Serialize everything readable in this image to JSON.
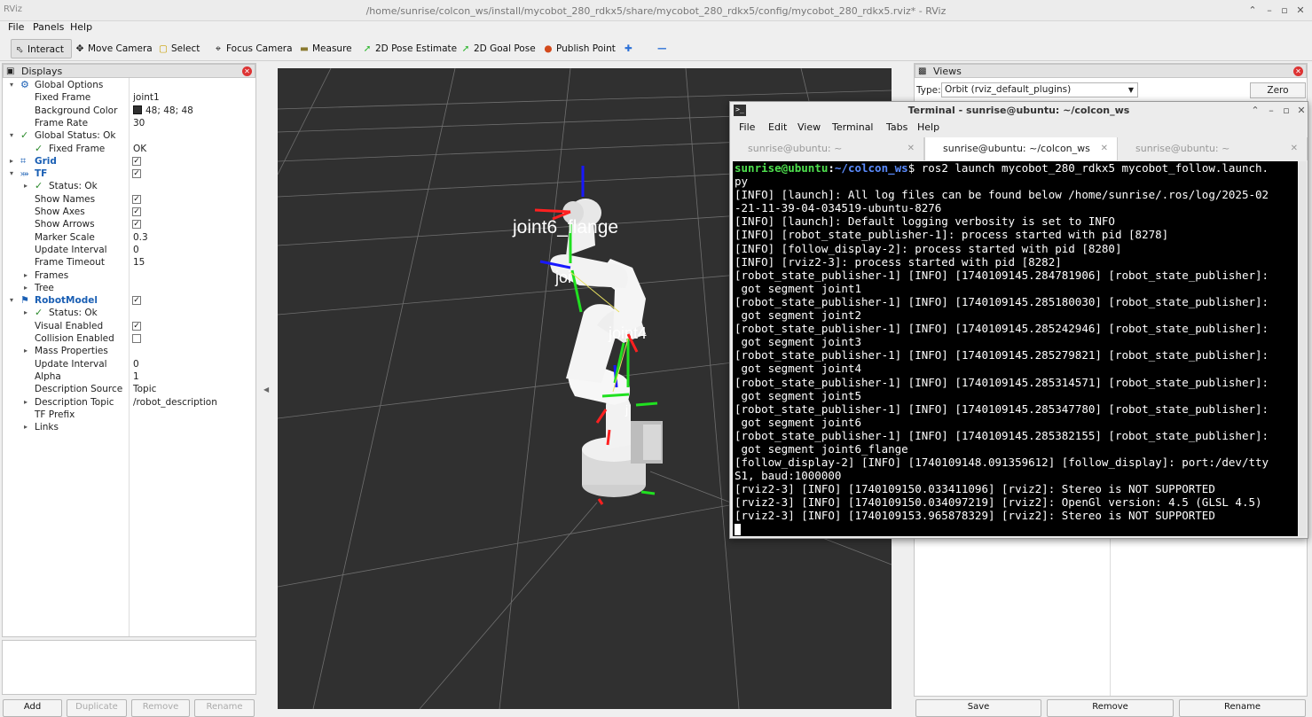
{
  "window": {
    "title": "/home/sunrise/colcon_ws/install/mycobot_280_rdkx5/share/mycobot_280_rdkx5/config/mycobot_280_rdkx5.rviz* - RViz",
    "logo": "RViz"
  },
  "menu": [
    "File",
    "Panels",
    "Help"
  ],
  "toolbar": {
    "interact": "Interact",
    "move_camera": "Move Camera",
    "select": "Select",
    "focus_camera": "Focus Camera",
    "measure": "Measure",
    "pose_estimate": "2D Pose Estimate",
    "goal_pose": "2D Goal Pose",
    "publish_point": "Publish Point"
  },
  "displays": {
    "title": "Displays",
    "rows": [
      {
        "name": "Global Options",
        "value": "",
        "depth": 0,
        "arrow": "open",
        "icon": "gear-icon",
        "check": null,
        "status": false,
        "blue": false
      },
      {
        "name": "Fixed Frame",
        "value": "joint1",
        "depth": 1,
        "arrow": "",
        "icon": "",
        "check": null,
        "status": false,
        "blue": false
      },
      {
        "name": "Background Color",
        "value": "48; 48; 48",
        "depth": 1,
        "arrow": "",
        "icon": "",
        "check": null,
        "status": false,
        "blue": false,
        "swatch": "#303030"
      },
      {
        "name": "Frame Rate",
        "value": "30",
        "depth": 1,
        "arrow": "",
        "icon": "",
        "check": null,
        "status": false,
        "blue": false
      },
      {
        "name": "Global Status: Ok",
        "value": "",
        "depth": 0,
        "arrow": "open",
        "icon": "",
        "check": null,
        "status": true,
        "blue": false
      },
      {
        "name": "Fixed Frame",
        "value": "OK",
        "depth": 1,
        "arrow": "",
        "icon": "",
        "check": null,
        "status": true,
        "blue": false
      },
      {
        "name": "Grid",
        "value": "",
        "depth": 0,
        "arrow": "closed",
        "icon": "grid-icon",
        "check": true,
        "status": false,
        "blue": true
      },
      {
        "name": "TF",
        "value": "",
        "depth": 0,
        "arrow": "open",
        "icon": "axes-icon",
        "check": true,
        "status": false,
        "blue": true
      },
      {
        "name": "Status: Ok",
        "value": "",
        "depth": 1,
        "arrow": "closed",
        "icon": "",
        "check": null,
        "status": true,
        "blue": false
      },
      {
        "name": "Show Names",
        "value": "",
        "depth": 1,
        "arrow": "",
        "icon": "",
        "check": true,
        "status": false,
        "blue": false
      },
      {
        "name": "Show Axes",
        "value": "",
        "depth": 1,
        "arrow": "",
        "icon": "",
        "check": true,
        "status": false,
        "blue": false
      },
      {
        "name": "Show Arrows",
        "value": "",
        "depth": 1,
        "arrow": "",
        "icon": "",
        "check": true,
        "status": false,
        "blue": false
      },
      {
        "name": "Marker Scale",
        "value": "0.3",
        "depth": 1,
        "arrow": "",
        "icon": "",
        "check": null,
        "status": false,
        "blue": false
      },
      {
        "name": "Update Interval",
        "value": "0",
        "depth": 1,
        "arrow": "",
        "icon": "",
        "check": null,
        "status": false,
        "blue": false
      },
      {
        "name": "Frame Timeout",
        "value": "15",
        "depth": 1,
        "arrow": "",
        "icon": "",
        "check": null,
        "status": false,
        "blue": false
      },
      {
        "name": "Frames",
        "value": "",
        "depth": 1,
        "arrow": "closed",
        "icon": "",
        "check": null,
        "status": false,
        "blue": false
      },
      {
        "name": "Tree",
        "value": "",
        "depth": 1,
        "arrow": "closed",
        "icon": "",
        "check": null,
        "status": false,
        "blue": false
      },
      {
        "name": "RobotModel",
        "value": "",
        "depth": 0,
        "arrow": "open",
        "icon": "robot-icon",
        "check": true,
        "status": false,
        "blue": true
      },
      {
        "name": "Status: Ok",
        "value": "",
        "depth": 1,
        "arrow": "closed",
        "icon": "",
        "check": null,
        "status": true,
        "blue": false
      },
      {
        "name": "Visual Enabled",
        "value": "",
        "depth": 1,
        "arrow": "",
        "icon": "",
        "check": true,
        "status": false,
        "blue": false
      },
      {
        "name": "Collision Enabled",
        "value": "",
        "depth": 1,
        "arrow": "",
        "icon": "",
        "check": false,
        "status": false,
        "blue": false
      },
      {
        "name": "Mass Properties",
        "value": "",
        "depth": 1,
        "arrow": "closed",
        "icon": "",
        "check": null,
        "status": false,
        "blue": false
      },
      {
        "name": "Update Interval",
        "value": "0",
        "depth": 1,
        "arrow": "",
        "icon": "",
        "check": null,
        "status": false,
        "blue": false
      },
      {
        "name": "Alpha",
        "value": "1",
        "depth": 1,
        "arrow": "",
        "icon": "",
        "check": null,
        "status": false,
        "blue": false
      },
      {
        "name": "Description Source",
        "value": "Topic",
        "depth": 1,
        "arrow": "",
        "icon": "",
        "check": null,
        "status": false,
        "blue": false
      },
      {
        "name": "Description Topic",
        "value": "/robot_description",
        "depth": 1,
        "arrow": "closed",
        "icon": "",
        "check": null,
        "status": false,
        "blue": false
      },
      {
        "name": "TF Prefix",
        "value": "",
        "depth": 1,
        "arrow": "",
        "icon": "",
        "check": null,
        "status": false,
        "blue": false
      },
      {
        "name": "Links",
        "value": "",
        "depth": 1,
        "arrow": "closed",
        "icon": "",
        "check": null,
        "status": false,
        "blue": false
      }
    ],
    "buttons": [
      "Add",
      "Duplicate",
      "Remove",
      "Rename"
    ]
  },
  "viewport": {
    "labels": [
      "joint6_flange",
      "joi",
      "joint4",
      "j"
    ]
  },
  "views": {
    "title": "Views",
    "type_label": "Type:",
    "type_value": "Orbit (rviz_default_plugins)",
    "zero_button": "Zero",
    "buttons": [
      "Save",
      "Remove",
      "Rename"
    ]
  },
  "terminal": {
    "title": "Terminal - sunrise@ubuntu: ~/colcon_ws",
    "menu": [
      "File",
      "Edit",
      "View",
      "Terminal",
      "Tabs",
      "Help"
    ],
    "tabs": [
      "sunrise@ubuntu: ~",
      "sunrise@ubuntu: ~/colcon_ws",
      "sunrise@ubuntu: ~"
    ],
    "prompt_user": "sunrise@ubuntu",
    "prompt_path": "~/colcon_ws",
    "command": "$ ros2 launch mycobot_280_rdkx5 mycobot_follow.launch.",
    "lines": [
      "py",
      "[INFO] [launch]: All log files can be found below /home/sunrise/.ros/log/2025-02",
      "-21-11-39-04-034519-ubuntu-8276",
      "[INFO] [launch]: Default logging verbosity is set to INFO",
      "[INFO] [robot_state_publisher-1]: process started with pid [8278]",
      "[INFO] [follow_display-2]: process started with pid [8280]",
      "[INFO] [rviz2-3]: process started with pid [8282]",
      "[robot_state_publisher-1] [INFO] [1740109145.284781906] [robot_state_publisher]:",
      " got segment joint1",
      "[robot_state_publisher-1] [INFO] [1740109145.285180030] [robot_state_publisher]:",
      " got segment joint2",
      "[robot_state_publisher-1] [INFO] [1740109145.285242946] [robot_state_publisher]:",
      " got segment joint3",
      "[robot_state_publisher-1] [INFO] [1740109145.285279821] [robot_state_publisher]:",
      " got segment joint4",
      "[robot_state_publisher-1] [INFO] [1740109145.285314571] [robot_state_publisher]:",
      " got segment joint5",
      "[robot_state_publisher-1] [INFO] [1740109145.285347780] [robot_state_publisher]:",
      " got segment joint6",
      "[robot_state_publisher-1] [INFO] [1740109145.285382155] [robot_state_publisher]:",
      " got segment joint6_flange",
      "[follow_display-2] [INFO] [1740109148.091359612] [follow_display]: port:/dev/tty",
      "S1, baud:1000000",
      "[rviz2-3] [INFO] [1740109150.033411096] [rviz2]: Stereo is NOT SUPPORTED",
      "[rviz2-3] [INFO] [1740109150.034097219] [rviz2]: OpenGl version: 4.5 (GLSL 4.5)",
      "[rviz2-3] [INFO] [1740109153.965878329] [rviz2]: Stereo is NOT SUPPORTED"
    ]
  }
}
